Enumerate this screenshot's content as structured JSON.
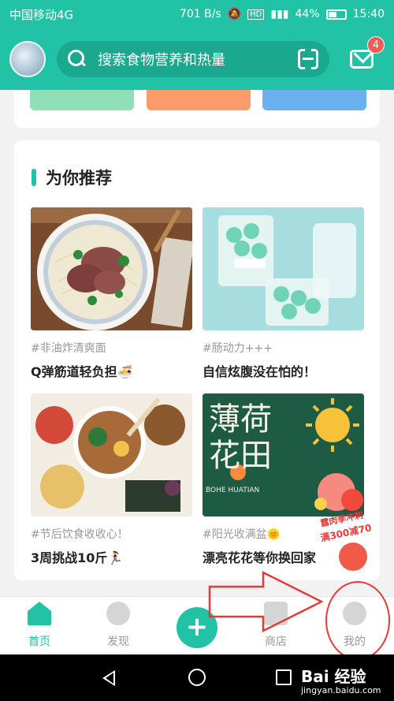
{
  "status_bar": {
    "carrier": "中国移动4G",
    "speed": "701 B/s",
    "hd": "HD",
    "battery": "44%",
    "time": "15:40"
  },
  "header": {
    "search_placeholder": "搜索食物营养和热量",
    "mail_badge": "4"
  },
  "recommend": {
    "title": "为你推荐",
    "cards": [
      {
        "tag": "#非油炸清爽面",
        "title": "Q弹筋道轻负担🍜"
      },
      {
        "tag": "#肠动力+++",
        "title": "自信炫腹没在怕的！"
      },
      {
        "tag": "#节后饮食收收心！",
        "title": "3周挑战10斤🏃‍♀️"
      },
      {
        "tag": "#阳光收满盆🌞",
        "title": "漂亮花花等你换回家"
      }
    ],
    "image_texts": {
      "card4_hanzi": "薄荷花田",
      "card4_pinyin": "BOHE HUATIAN",
      "promo_line1": "露肉季冲刺",
      "promo_line2": "满300减70"
    }
  },
  "nav": {
    "items": [
      {
        "label": "首页"
      },
      {
        "label": "发现"
      },
      {
        "label": "商店"
      },
      {
        "label": "我的"
      }
    ],
    "plus": "+"
  },
  "watermark": {
    "brand": "Bai 经验",
    "url": "jingyan.baidu.com"
  },
  "colors": {
    "primary": "#21c2a6",
    "badge": "#f15b55",
    "annotation": "#e53a3a"
  }
}
